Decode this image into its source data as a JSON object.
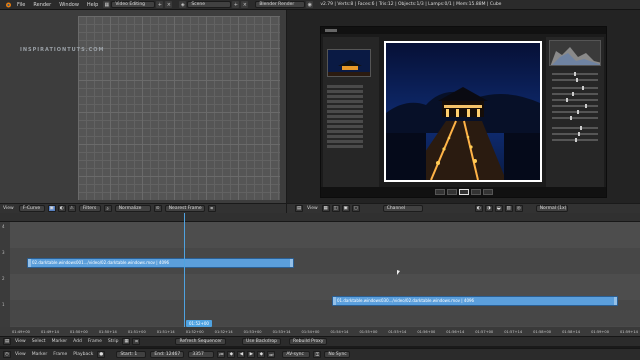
{
  "topbar": {
    "menus": [
      "File",
      "Render",
      "Window",
      "Help"
    ],
    "screen_layout": "Video Editing",
    "scene": "Scene",
    "render_engine": "Blender Render",
    "stats": "v2.79 | Verts:8 | Faces:6 | Tris:12 | Objects:1/3 | Lamps:0/1 | Mem:15.88M | Cube"
  },
  "graph_editor": {
    "watermark": "INSPIRATIONTUTS.COM",
    "x_ticks": [
      "4800",
      "5200",
      "5400",
      "5600",
      "6000",
      "6200"
    ],
    "header": {
      "mode": "F-Curve",
      "filters": "Filters",
      "normalize": "Normalize",
      "pivot": "Nearest Frame"
    }
  },
  "image_preview": {
    "header": {
      "view": "View",
      "channel": "Channel",
      "display_mode": "Normal (1x)"
    }
  },
  "sequencer": {
    "header": {
      "view": "View",
      "select": "Select",
      "marker": "Marker",
      "add": "Add",
      "frame": "Frame",
      "strip": "Strip",
      "refresh": "Refresh Sequencer",
      "use_backdrop": "Use Backdrop",
      "proxy": "Rebuild Proxy"
    },
    "strips": [
      {
        "label": "02.darktable.windows001.../video/02.darktable.windows.mov | 4096",
        "channel": 3
      },
      {
        "label": "01.darktable.windows030.../video/02.darktable.windows.mov | 4096",
        "channel": 1
      }
    ],
    "current_frame": "01:52+00",
    "timecodes": [
      "01:49+00",
      "01:49+14",
      "01:50+00",
      "01:50+14",
      "01:51+00",
      "01:51+14",
      "01:52+00",
      "01:52+14",
      "01:53+00",
      "01:53+14",
      "01:54+00",
      "01:54+14",
      "01:55+00",
      "01:55+14",
      "01:56+00",
      "01:56+14",
      "01:57+00",
      "01:57+14",
      "01:58+00",
      "01:58+14",
      "01:59+00",
      "01:59+14",
      "02:00+00",
      "02:00+14",
      "02:01+00",
      "02:01+14",
      "02:02+00"
    ],
    "channel_numbers": [
      "4",
      "3",
      "2",
      "1"
    ]
  },
  "timeline": {
    "menus": [
      "View",
      "Marker",
      "Frame",
      "Playback"
    ],
    "start_label": "Start:",
    "start_value": "1",
    "end_label": "End:",
    "end_value": "12467",
    "current_value": "3357",
    "sync": "AV-sync",
    "keying": "No Sync"
  },
  "colors": {
    "strip_blue": "#5b9fdc",
    "playhead": "#4fa2e0",
    "ui_bg": "#2b2b2b"
  }
}
